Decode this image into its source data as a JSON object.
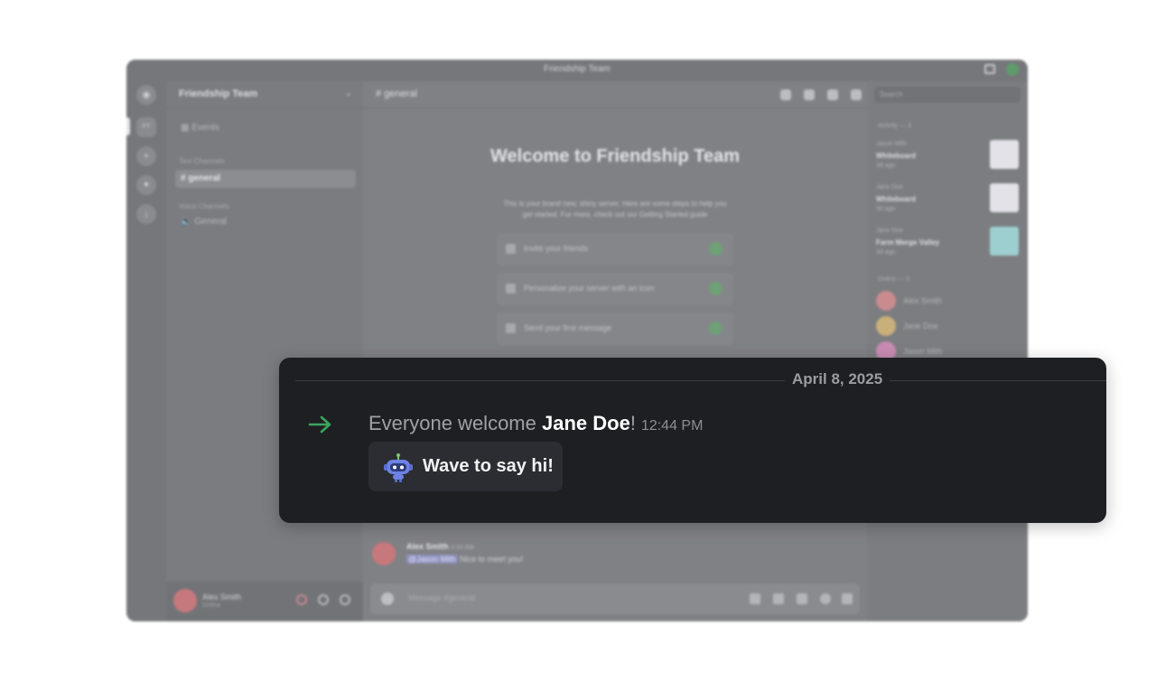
{
  "app": {
    "window_title": "Friendship Team",
    "server_name": "Friendship Team",
    "events_label": "Events",
    "text_channels_label": "Text Channels",
    "voice_channels_label": "Voice Channels",
    "text_channel": "general",
    "voice_channel": "General",
    "channel_header": "general",
    "user": {
      "name": "Alex Smith",
      "status": "Online"
    },
    "welcome_title": "Welcome to Friendship Team",
    "welcome_text": "This is your brand new, shiny server. Here are some steps to help you get started. For more, check out our Getting Started guide",
    "tasks": [
      "Invite your friends",
      "Personalize your server with an icon",
      "Send your first message"
    ],
    "composer_placeholder": "Message #general",
    "search_placeholder": "Search",
    "activity_label": "Activity — 3",
    "activity": [
      {
        "who": "Jason Mith",
        "what": "Whiteboard",
        "when": "3d ago"
      },
      {
        "who": "Jane Doe",
        "what": "Whiteboard",
        "when": "3d ago"
      },
      {
        "who": "Jane Doe",
        "what": "Farm Merge Valley",
        "when": "3d ago"
      }
    ],
    "online_label": "Online — 3",
    "members": [
      "Alex Smith",
      "Jane Doe",
      "Jason Mith"
    ],
    "bottom_message": {
      "author": "Alex Smith",
      "time": "3:33 AM",
      "mention": "@Jason Mith",
      "text": "Nice to meet you!"
    }
  },
  "card": {
    "date": "April 8, 2025",
    "welcome_prefix": "Everyone welcome ",
    "new_member": "Jane Doe",
    "suffix": "!",
    "time": "12:44 PM",
    "wave_button": "Wave to say hi!"
  },
  "colors": {
    "arrow": "#3ba55c",
    "card_bg": "#1e1f23",
    "button_bg": "#2c2d32"
  }
}
